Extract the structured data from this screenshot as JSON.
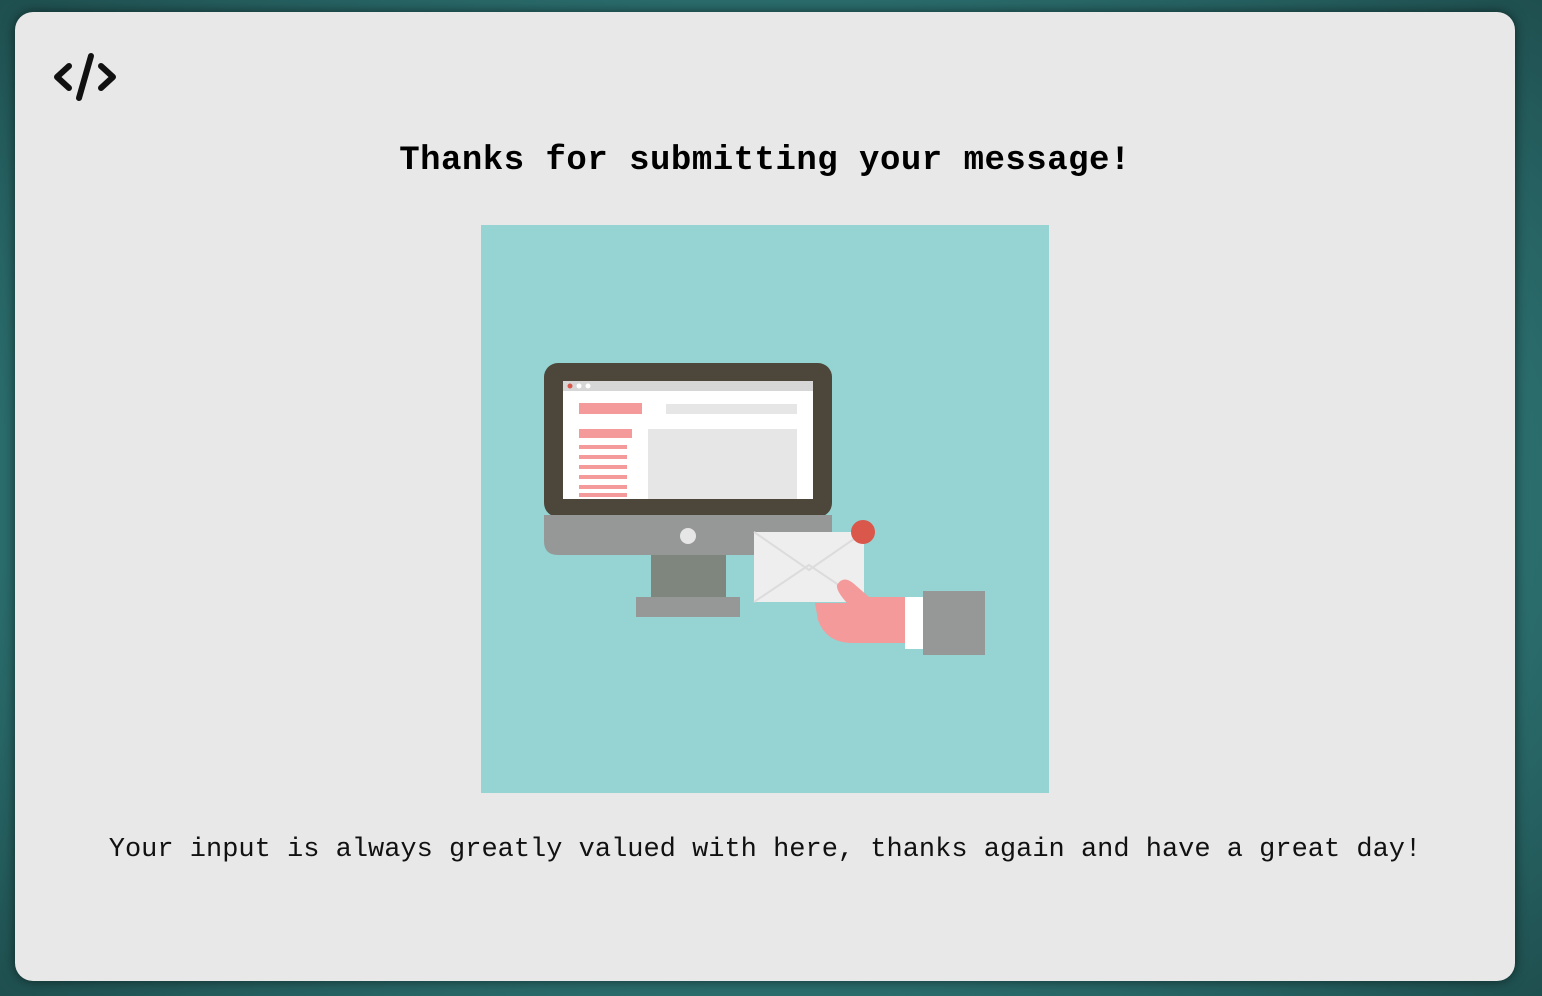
{
  "header": {
    "logo_icon": "code-brackets-icon"
  },
  "main": {
    "title": "Thanks for submitting your message!",
    "illustration": {
      "icon": "computer-with-envelope-illustration",
      "background_color": "#95d4d3"
    },
    "message": "Your input is always greatly valued with here, thanks again and have a great day!"
  },
  "colors": {
    "page_background": "#2f7777",
    "card_background": "#e8e8e8",
    "text": "#000000",
    "accent_pink": "#f49a9a",
    "accent_red": "#d9574b"
  }
}
